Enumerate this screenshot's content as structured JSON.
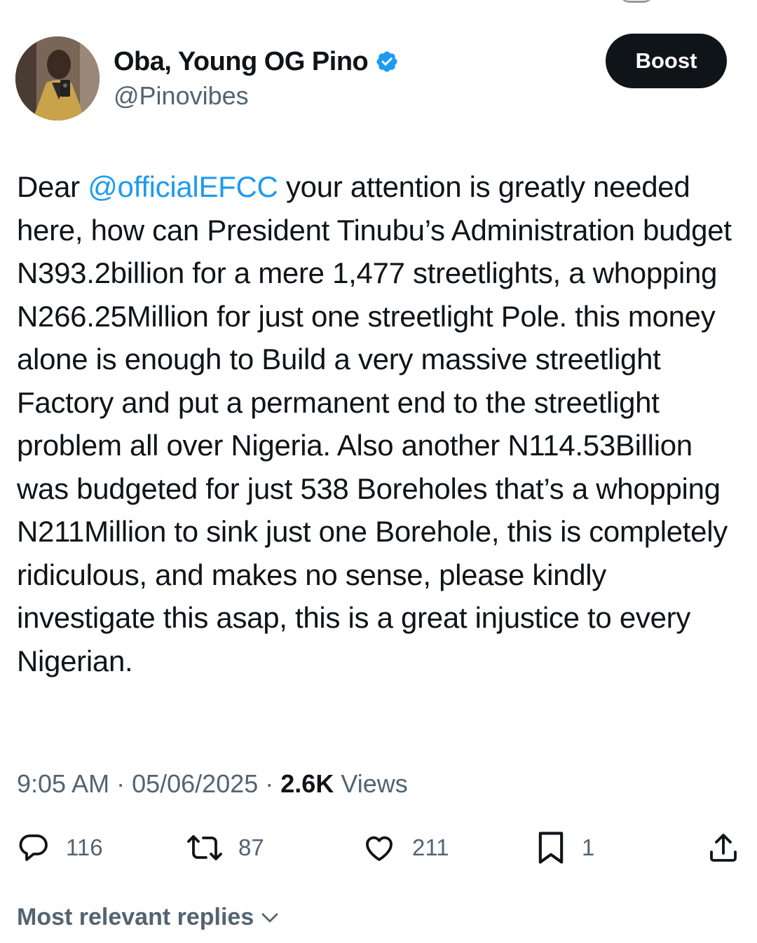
{
  "author": {
    "display_name": "Oba, Young OG Pino",
    "handle": "@Pinovibes",
    "verified": true,
    "verified_color": "#1d9bf0"
  },
  "header": {
    "boost_label": "Boost"
  },
  "tweet": {
    "text_prefix": "Dear ",
    "mention": "@officialEFCC",
    "text_rest": " your attention is greatly needed here, how can President Tinubu’s Administration budget N393.2billion for a mere 1,477 streetlights, a whopping N266.25Million for just one streetlight Pole. this money alone is enough to Build a very massive streetlight Factory and put a permanent end to the streetlight problem all over Nigeria. Also another N114.53Billion was budgeted for just 538 Boreholes that’s a whopping N211Million to sink just one Borehole, this is completely ridiculous, and makes no sense, please kindly investigate this asap, this is a great injustice to every Nigerian."
  },
  "meta": {
    "time": "9:05 AM",
    "separator": " · ",
    "date": "05/06/2025",
    "views_count": "2.6K",
    "views_label": " Views"
  },
  "actions": {
    "replies": "116",
    "reposts": "87",
    "likes": "211",
    "bookmarks": "1"
  },
  "replies_sort": {
    "label": "Most relevant replies"
  },
  "colors": {
    "text": "#0f1419",
    "secondary": "#536471",
    "accent": "#1d9bf0",
    "button_bg": "#0f1419"
  },
  "icons": [
    "verified-badge-icon",
    "reply-icon",
    "repost-icon",
    "like-icon",
    "bookmark-icon",
    "share-icon",
    "chevron-down-icon"
  ]
}
